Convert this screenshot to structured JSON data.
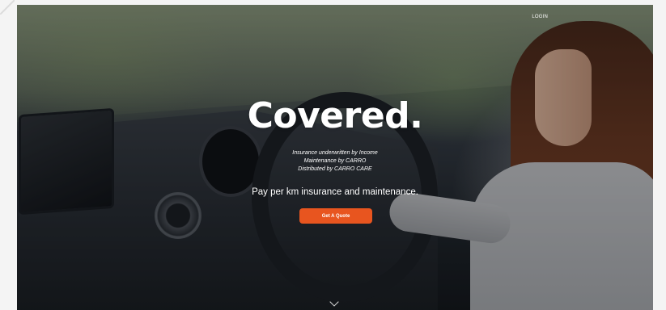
{
  "header": {
    "login_label": "LOGIN"
  },
  "hero": {
    "headline": "Covered.",
    "lines": [
      "Insurance underwritten by Income",
      "Maintenance by CARRO",
      "Distributed by CARRO CARE"
    ],
    "tagline": "Pay per km insurance and maintenance.",
    "cta_label": "Get A Quote"
  },
  "icons": {
    "scroll": "chevron-down-icon"
  },
  "colors": {
    "accent": "#e8551f",
    "text": "#ffffff"
  }
}
